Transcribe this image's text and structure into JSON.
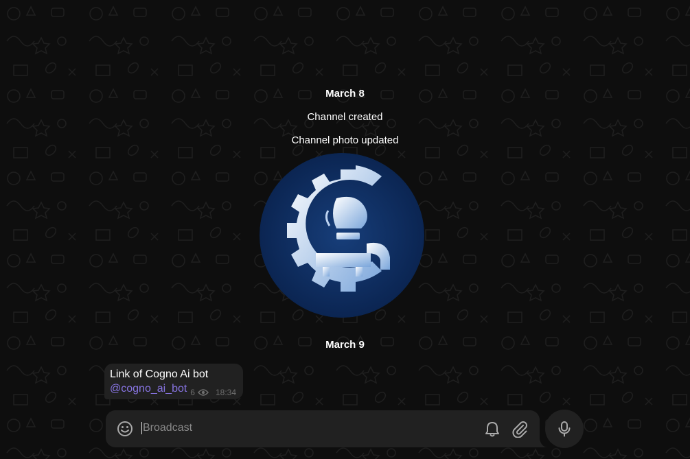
{
  "service": {
    "date1": "March 8",
    "created": "Channel created",
    "photo_updated": "Channel photo updated",
    "date2": "March 9"
  },
  "message": {
    "text": "Link of Cogno Ai bot",
    "link": "@cogno_ai_bot",
    "views": "6",
    "time": "18:34"
  },
  "composer": {
    "placeholder": "Broadcast"
  },
  "icons": {
    "emoji": "smile-icon",
    "bell": "bell-icon",
    "attach": "paperclip-icon",
    "mic": "microphone-icon",
    "views": "eye-icon"
  },
  "colors": {
    "background": "#0e0e0e",
    "bubble": "#212121",
    "link": "#8774e1",
    "photo_bg": "#0e2c5e"
  }
}
